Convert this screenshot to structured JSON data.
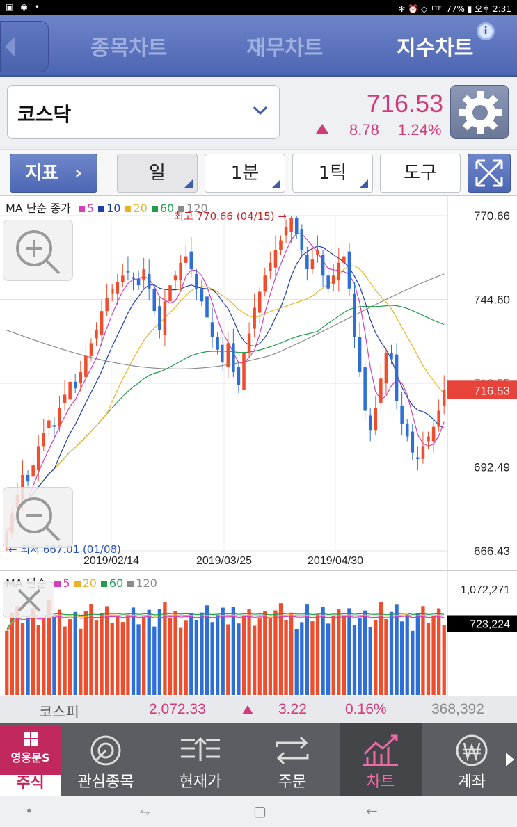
{
  "statusbar": {
    "right_text": "77% ▮ 오후 2:31",
    "lte": "LTE"
  },
  "tabs": [
    {
      "label": "종목차트",
      "active": false
    },
    {
      "label": "재무차트",
      "active": false
    },
    {
      "label": "지수차트",
      "active": true
    }
  ],
  "index": {
    "name": "코스닥",
    "price": "716.53",
    "change": "8.78",
    "change_pct": "1.24%",
    "up_color": "#d13b7a"
  },
  "toolbar": {
    "indicator": "지표",
    "period": "일",
    "minute": "1분",
    "tick": "1틱",
    "tools": "도구"
  },
  "price_chart": {
    "legend_prefix": "MA 단순 종가",
    "ma_items": [
      {
        "label": "5",
        "color": "#d63fb8"
      },
      {
        "label": "10",
        "color": "#1f3fa8"
      },
      {
        "label": "20",
        "color": "#e8b426"
      },
      {
        "label": "60",
        "color": "#1e9e4a"
      },
      {
        "label": "120",
        "color": "#8a8a8a"
      }
    ],
    "y_labels": [
      "770.66",
      "744.60",
      "718.55",
      "692.49",
      "666.43"
    ],
    "current_price_tag": "716.53",
    "x_labels": [
      "2019/02/14",
      "2019/03/25",
      "2019/04/30"
    ],
    "high_note": "최고 770.66 (04/15) →",
    "low_note": "← 최저 667.01 (01/08)"
  },
  "volume_chart": {
    "legend_prefix": "MA 단순",
    "ma_items": [
      {
        "label": "5",
        "color": "#d63fb8"
      },
      {
        "label": "20",
        "color": "#e8b426"
      },
      {
        "label": "60",
        "color": "#1e9e4a"
      },
      {
        "label": "120",
        "color": "#8a8a8a"
      }
    ],
    "y_top": "1,072,271",
    "current_volume_tag": "723,224"
  },
  "kospi": {
    "name": "코스피",
    "value": "2,072.33",
    "change": "3.22",
    "pct": "0.16%",
    "volume": "368,392"
  },
  "nav": {
    "brand": "영웅문S",
    "brand_sub": "주식",
    "items": [
      "관심종목",
      "현재가",
      "주문",
      "차트",
      "계좌"
    ],
    "active": "차트"
  },
  "chart_data": {
    "type": "candlestick",
    "title": "",
    "ylim": [
      666.43,
      770.66
    ],
    "y_ticks": [
      770.66,
      744.6,
      718.55,
      692.49,
      666.43
    ],
    "x_tick_labels": [
      "2019/02/14",
      "2019/03/25",
      "2019/04/30"
    ],
    "close_series": [
      672,
      678,
      684,
      690,
      688,
      693,
      699,
      703,
      707,
      705,
      711,
      715,
      719,
      717,
      722,
      727,
      731,
      735,
      741,
      745,
      748,
      750,
      752,
      753,
      751,
      749,
      754,
      748,
      741,
      735,
      744,
      749,
      752,
      756,
      758,
      754,
      748,
      744,
      739,
      733,
      729,
      725,
      731,
      722,
      718,
      728,
      734,
      742,
      747,
      752,
      756,
      760,
      763,
      767,
      770,
      765,
      760,
      754,
      757,
      760,
      752,
      748,
      752,
      756,
      758,
      748,
      733,
      722,
      710,
      704,
      711,
      720,
      728,
      726,
      713,
      706,
      702,
      697,
      695,
      699,
      702,
      705,
      710,
      716.53
    ],
    "high": {
      "value": 770.66,
      "date": "04/15"
    },
    "low": {
      "value": 667.01,
      "date": "01/08"
    },
    "last": 716.53,
    "volume_ylim": [
      0,
      1072271
    ],
    "volume_last": 723224
  }
}
